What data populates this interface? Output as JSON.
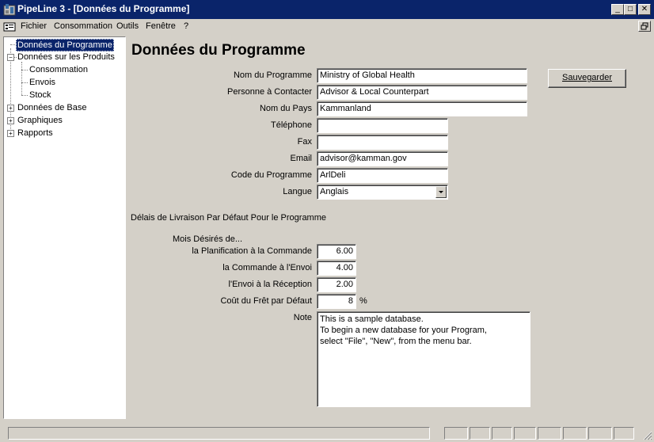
{
  "window": {
    "title": "PipeLine 3 - [Données du Programme]",
    "icon": "pipeline-app-icon",
    "controls": {
      "minimize": "_",
      "maximize": "□",
      "close": "✕"
    }
  },
  "menubar": {
    "items": [
      {
        "label": "Fichier",
        "underline": "F"
      },
      {
        "label": "Consommation",
        "underline": "m"
      },
      {
        "label": "Outils",
        "underline": "O"
      },
      {
        "label": "Fenêtre",
        "underline": "n"
      },
      {
        "label": "?",
        "underline": "?"
      }
    ]
  },
  "tree": {
    "nodes": [
      {
        "label": "Données du Programme",
        "selected": true
      },
      {
        "label": "Données sur les Produits",
        "expander": "−"
      },
      {
        "label": "Consommation"
      },
      {
        "label": "Envois"
      },
      {
        "label": "Stock"
      },
      {
        "label": "Données de Base",
        "expander": "+"
      },
      {
        "label": "Graphiques",
        "expander": "+"
      },
      {
        "label": "Rapports",
        "expander": "+"
      }
    ]
  },
  "form": {
    "title": "Données du Programme",
    "save_button": "Sauvegarder",
    "fields": {
      "program_name": {
        "label": "Nom du Programme",
        "value": "Ministry of Global Health"
      },
      "contact": {
        "label": "Personne à Contacter",
        "value": "Advisor & Local Counterpart"
      },
      "country": {
        "label": "Nom du Pays",
        "value": "Kammanland"
      },
      "phone": {
        "label": "Téléphone",
        "value": ""
      },
      "fax": {
        "label": "Fax",
        "value": ""
      },
      "email": {
        "label": "Email",
        "value": "advisor@kamman.gov"
      },
      "program_code": {
        "label": "Code du Programme",
        "value": "ArlDeli"
      },
      "language": {
        "label": "Langue",
        "value": "Anglais"
      }
    },
    "delivery": {
      "section_title": "Délais de Livraison Par Défaut Pour le Programme",
      "months_label": "Mois Désirés de...",
      "planning_to_order": {
        "label": "la Planification à la Commande",
        "value": "6.00"
      },
      "order_to_shipment": {
        "label": "la Commande à l'Envoi",
        "value": "4.00"
      },
      "shipment_to_receipt": {
        "label": "l'Envoi à la Réception",
        "value": "2.00"
      },
      "freight_cost": {
        "label": "Coût du Frêt par Défaut",
        "value": "8",
        "unit": "%"
      }
    },
    "note": {
      "label": "Note",
      "value": "This is a sample database.\nTo begin a new database for your Program,\nselect \"File\", \"New\", from the menu bar."
    }
  },
  "colors": {
    "titlebar": "#0a246a",
    "face": "#d4d0c8",
    "selection": "#0a246a"
  }
}
